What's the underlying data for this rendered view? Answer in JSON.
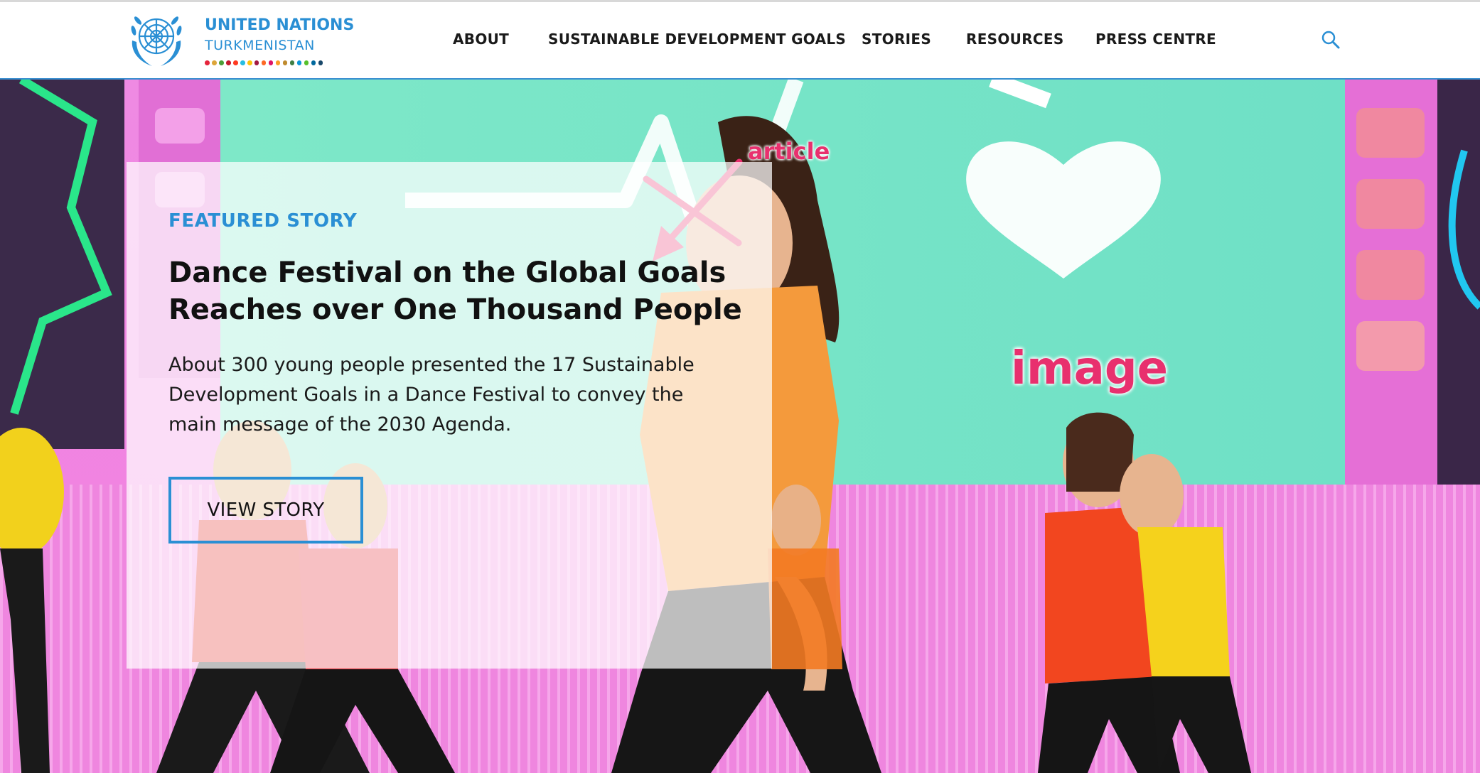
{
  "brand": {
    "name_line1": "UNITED NATIONS",
    "name_line2": "TURKMENISTAN",
    "accent": "#2a8fd4",
    "sdg_dot_colors": [
      "#e5243b",
      "#dda63a",
      "#4c9f38",
      "#c5192d",
      "#ff3a21",
      "#26bde2",
      "#fcc30b",
      "#a21942",
      "#fd6925",
      "#dd1367",
      "#fd9d24",
      "#bf8b2e",
      "#3f7e44",
      "#0a97d9",
      "#56c02b",
      "#00689d",
      "#19486a"
    ]
  },
  "nav": {
    "items": [
      {
        "label": "ABOUT"
      },
      {
        "label": "SUSTAINABLE DEVELOPMENT GOALS"
      },
      {
        "label": "STORIES"
      },
      {
        "label": "RESOURCES"
      },
      {
        "label": "PRESS CENTRE"
      }
    ],
    "search_icon": "search-icon"
  },
  "featured": {
    "eyebrow": "FEATURED STORY",
    "headline_line1": "Dance Festival on the Global Goals",
    "headline_line2": "Reaches over One Thousand People",
    "summary": "About 300 young people presented the 17 Sustainable Development Goals in a Dance Festival to convey the main message of the 2030 Agenda.",
    "cta_label": "VIEW STORY"
  },
  "annotations": {
    "article": "article",
    "image": "image",
    "color": "#e8306e"
  }
}
